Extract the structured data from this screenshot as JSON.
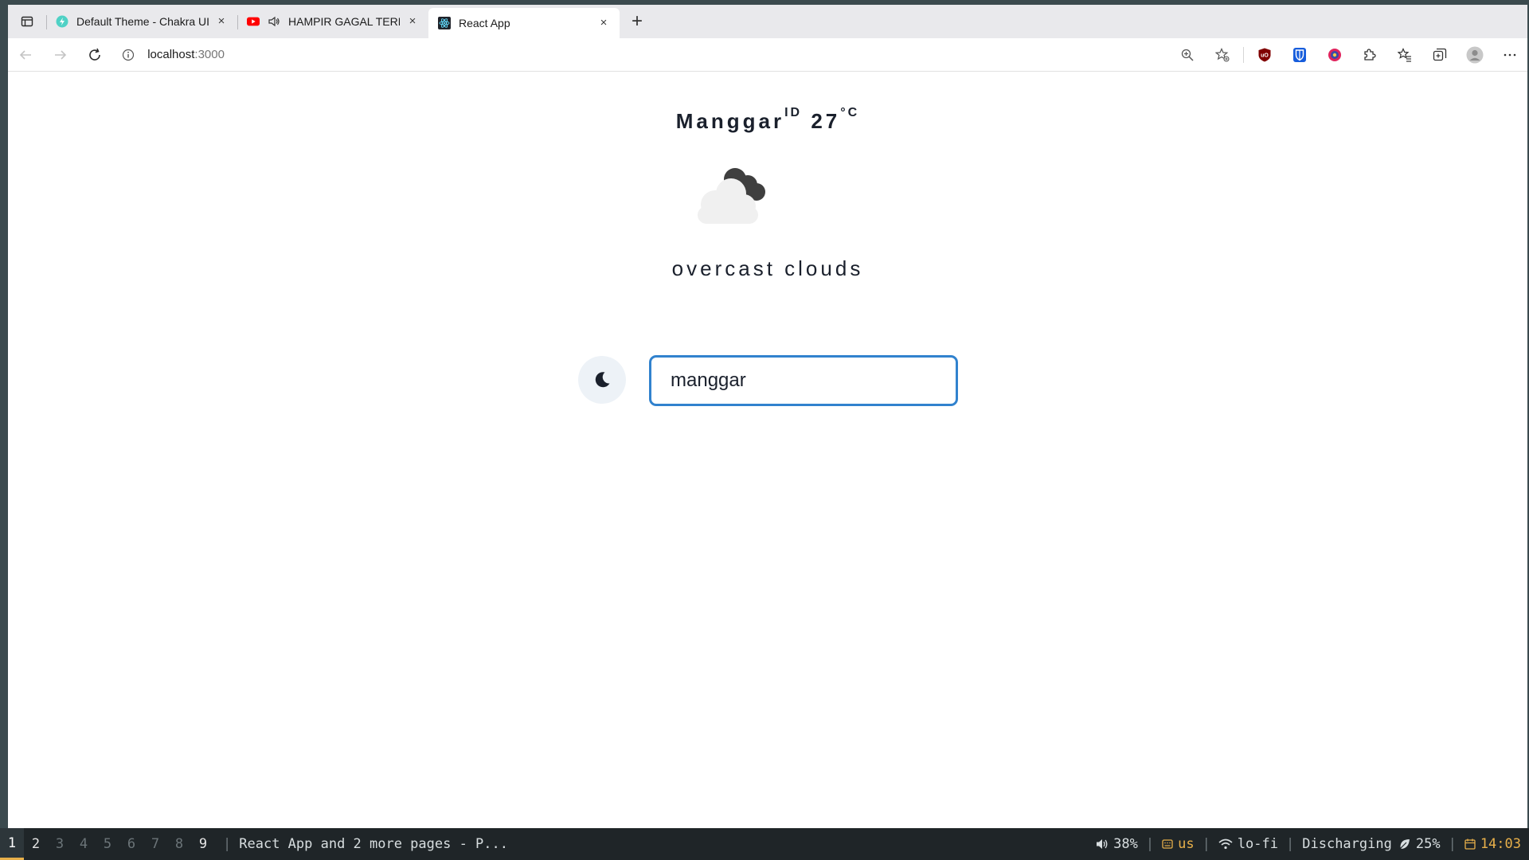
{
  "browser": {
    "tabs": [
      {
        "title": "Default Theme - Chakra UI",
        "favicon": "chakra-icon",
        "close": "×"
      },
      {
        "title": "HAMPIR GAGAL TERBANG",
        "favicon": "youtube-icon",
        "audio": "speaker-icon",
        "close": "×"
      },
      {
        "title": "React App",
        "favicon": "react-icon",
        "close": "×",
        "active": true
      }
    ],
    "new_tab": "+",
    "url_host": "localhost",
    "url_port": ":3000"
  },
  "weather": {
    "city": "Manggar",
    "country": "ID",
    "temperature": "27",
    "unit": "°C",
    "icon": "overcast-clouds-icon",
    "description": "overcast clouds"
  },
  "search": {
    "value": "manggar"
  },
  "theme_toggle": {
    "icon": "moon-icon"
  },
  "statusbar": {
    "workspaces": [
      "1",
      "2",
      "3",
      "4",
      "5",
      "6",
      "7",
      "8",
      "9"
    ],
    "current_workspace": "1",
    "separator": "|",
    "window_title": "React App and 2 more pages - P...",
    "volume": "38%",
    "keyboard": "us",
    "wifi": "lo-fi",
    "battery_status": "Discharging",
    "battery": "25%",
    "time": "14:03"
  },
  "colors": {
    "accent": "#3182ce",
    "text": "#1a202c",
    "toggle_bg": "#edf2f7",
    "status_accent": "#e8b04a"
  }
}
